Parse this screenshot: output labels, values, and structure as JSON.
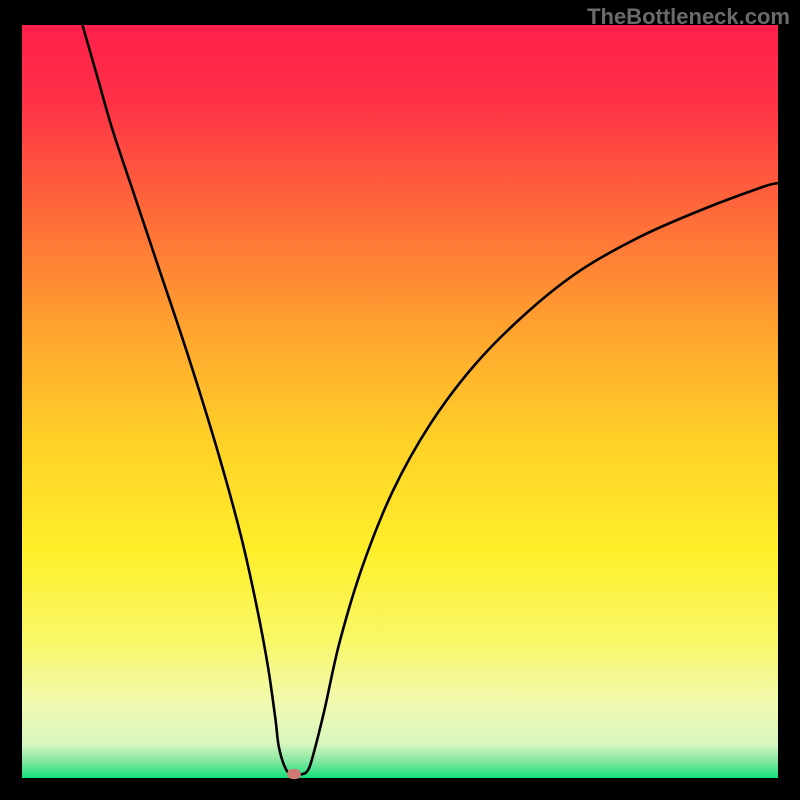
{
  "watermark": "TheBottleneck.com",
  "chart_data": {
    "type": "line",
    "title": "",
    "xlabel": "",
    "ylabel": "",
    "xlim": [
      0,
      100
    ],
    "ylim": [
      0,
      100
    ],
    "gradient_stops": [
      {
        "offset": 0.0,
        "color": "#ff1f4b"
      },
      {
        "offset": 0.1,
        "color": "#ff3147"
      },
      {
        "offset": 0.25,
        "color": "#ff6a3a"
      },
      {
        "offset": 0.4,
        "color": "#ffa22f"
      },
      {
        "offset": 0.55,
        "color": "#ffd028"
      },
      {
        "offset": 0.7,
        "color": "#ffef2a"
      },
      {
        "offset": 0.82,
        "color": "#f8f86a"
      },
      {
        "offset": 0.9,
        "color": "#f2f9b0"
      },
      {
        "offset": 0.955,
        "color": "#d8f6c0"
      },
      {
        "offset": 0.975,
        "color": "#8fe9a4"
      },
      {
        "offset": 1.0,
        "color": "#14e07a"
      }
    ],
    "series": [
      {
        "name": "bottleneck-curve",
        "x": [
          8,
          10,
          12,
          15,
          18,
          22,
          26,
          29,
          31,
          32.5,
          33.5,
          34,
          35,
          36,
          37,
          37.8,
          38.5,
          40,
          42,
          45,
          49,
          54,
          60,
          67,
          74,
          82,
          90,
          98,
          100
        ],
        "y": [
          100,
          93,
          86,
          77,
          68,
          56,
          43,
          32,
          23,
          15,
          8,
          4,
          1,
          0.5,
          0.5,
          1,
          3,
          9,
          18,
          28,
          38,
          47,
          55,
          62,
          67.5,
          72,
          75.5,
          78.5,
          79
        ]
      }
    ],
    "marker": {
      "x": 36,
      "y": 0.5
    }
  }
}
